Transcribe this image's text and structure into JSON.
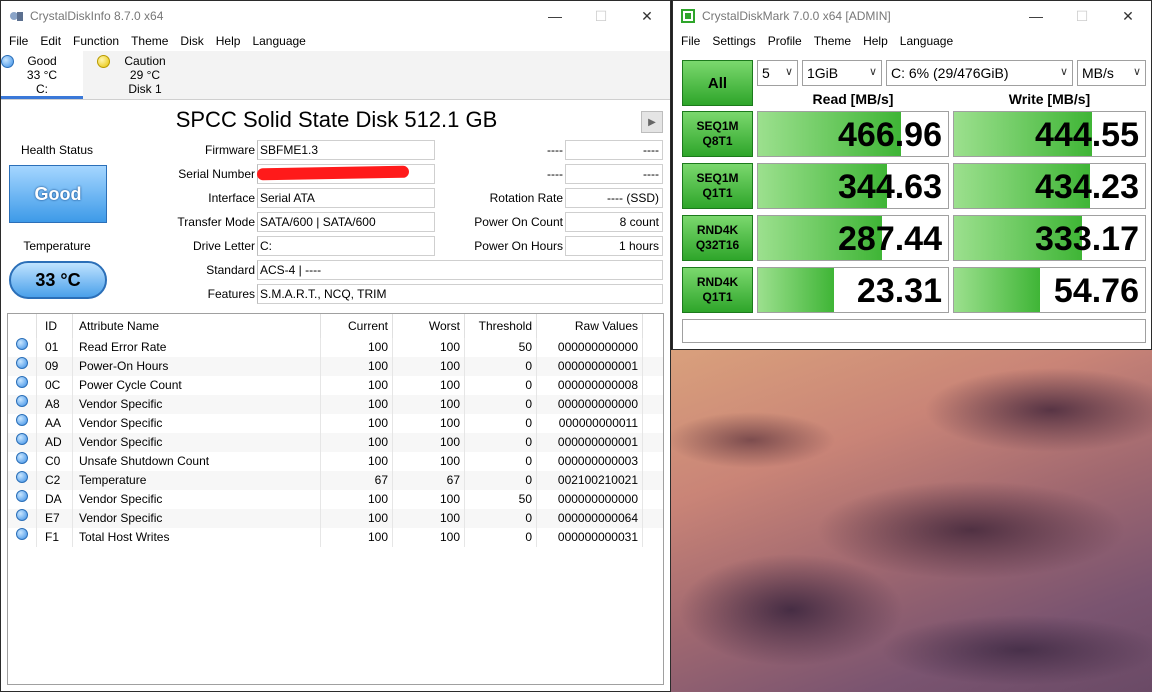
{
  "cdi": {
    "title": "CrystalDiskInfo 8.7.0 x64",
    "menu": [
      "File",
      "Edit",
      "Function",
      "Theme",
      "Disk",
      "Help",
      "Language"
    ],
    "disks": [
      {
        "status": "Good",
        "temp": "33 °C",
        "name": "C:"
      },
      {
        "status": "Caution",
        "temp": "29 °C",
        "name": "Disk 1"
      }
    ],
    "model": "SPCC Solid State Disk 512.1 GB",
    "health_label": "Health Status",
    "health_value": "Good",
    "temp_label": "Temperature",
    "temp_value": "33 °C",
    "fields": {
      "firmware_label": "Firmware",
      "firmware": "SBFME1.3",
      "serial_label": "Serial Number",
      "serial": "",
      "interface_label": "Interface",
      "interface": "Serial ATA",
      "transfer_label": "Transfer Mode",
      "transfer": "SATA/600 | SATA/600",
      "letter_label": "Drive Letter",
      "letter": "C:",
      "standard_label": "Standard",
      "standard": "ACS-4 | ----",
      "features_label": "Features",
      "features": "S.M.A.R.T., NCQ, TRIM",
      "r1_label": "----",
      "r1": "----",
      "r2_label": "----",
      "r2": "----",
      "rotation_label": "Rotation Rate",
      "rotation": "---- (SSD)",
      "poc_label": "Power On Count",
      "poc": "8 count",
      "poh_label": "Power On Hours",
      "poh": "1 hours"
    },
    "table": {
      "headers": [
        "ID",
        "Attribute Name",
        "Current",
        "Worst",
        "Threshold",
        "Raw Values"
      ],
      "rows": [
        [
          "01",
          "Read Error Rate",
          "100",
          "100",
          "50",
          "000000000000"
        ],
        [
          "09",
          "Power-On Hours",
          "100",
          "100",
          "0",
          "000000000001"
        ],
        [
          "0C",
          "Power Cycle Count",
          "100",
          "100",
          "0",
          "000000000008"
        ],
        [
          "A8",
          "Vendor Specific",
          "100",
          "100",
          "0",
          "000000000000"
        ],
        [
          "AA",
          "Vendor Specific",
          "100",
          "100",
          "0",
          "000000000011"
        ],
        [
          "AD",
          "Vendor Specific",
          "100",
          "100",
          "0",
          "000000000001"
        ],
        [
          "C0",
          "Unsafe Shutdown Count",
          "100",
          "100",
          "0",
          "000000000003"
        ],
        [
          "C2",
          "Temperature",
          "67",
          "67",
          "0",
          "002100210021"
        ],
        [
          "DA",
          "Vendor Specific",
          "100",
          "100",
          "50",
          "000000000000"
        ],
        [
          "E7",
          "Vendor Specific",
          "100",
          "100",
          "0",
          "000000000064"
        ],
        [
          "F1",
          "Total Host Writes",
          "100",
          "100",
          "0",
          "000000000031"
        ]
      ]
    }
  },
  "cdm": {
    "title": "CrystalDiskMark 7.0.0 x64 [ADMIN]",
    "menu": [
      "File",
      "Settings",
      "Profile",
      "Theme",
      "Help",
      "Language"
    ],
    "all_label": "All",
    "count": "5",
    "size": "1GiB",
    "drive": "C: 6% (29/476GiB)",
    "unit": "MB/s",
    "read_header": "Read [MB/s]",
    "write_header": "Write [MB/s]",
    "tests": [
      {
        "l1": "SEQ1M",
        "l2": "Q8T1",
        "read": "466.96",
        "write": "444.55",
        "read_frac": 0.75,
        "write_frac": 0.72
      },
      {
        "l1": "SEQ1M",
        "l2": "Q1T1",
        "read": "344.63",
        "write": "434.23",
        "read_frac": 0.68,
        "write_frac": 0.71
      },
      {
        "l1": "RND4K",
        "l2": "Q32T16",
        "read": "287.44",
        "write": "333.17",
        "read_frac": 0.65,
        "write_frac": 0.67
      },
      {
        "l1": "RND4K",
        "l2": "Q1T1",
        "read": "23.31",
        "write": "54.76",
        "read_frac": 0.4,
        "write_frac": 0.45
      }
    ]
  }
}
